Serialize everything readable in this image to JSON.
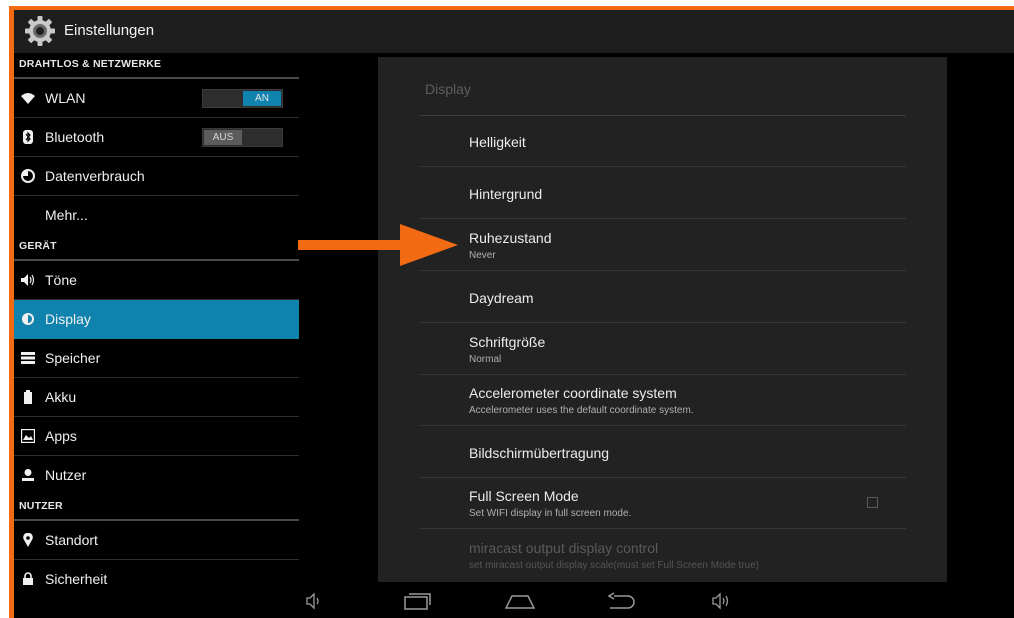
{
  "colors": {
    "accent": "#0f82ad",
    "frame": "#f26b12",
    "arrow": "#f26b12"
  },
  "actionbar": {
    "title": "Einstellungen",
    "icon": "gear-icon"
  },
  "sidebar": {
    "sections": [
      {
        "header": "DRAHTLOS & NETZWERKE",
        "items": [
          {
            "label": "WLAN",
            "icon": "wifi-icon",
            "toggle": "AN"
          },
          {
            "label": "Bluetooth",
            "icon": "bluetooth-icon",
            "toggle": "AUS"
          },
          {
            "label": "Datenverbrauch",
            "icon": "data-usage-icon"
          },
          {
            "label": "Mehr...",
            "icon": ""
          }
        ]
      },
      {
        "header": "GERÄT",
        "items": [
          {
            "label": "Töne",
            "icon": "speaker-icon"
          },
          {
            "label": "Display",
            "icon": "brightness-icon",
            "selected": true
          },
          {
            "label": "Speicher",
            "icon": "storage-icon"
          },
          {
            "label": "Akku",
            "icon": "battery-icon"
          },
          {
            "label": "Apps",
            "icon": "apps-icon"
          },
          {
            "label": "Nutzer",
            "icon": "user-icon"
          }
        ]
      },
      {
        "header": "NUTZER",
        "items": [
          {
            "label": "Standort",
            "icon": "location-icon"
          },
          {
            "label": "Sicherheit",
            "icon": "lock-icon"
          }
        ]
      }
    ]
  },
  "display": {
    "title": "Display",
    "rows": [
      {
        "title": "Helligkeit"
      },
      {
        "title": "Hintergrund"
      },
      {
        "title": "Ruhezustand",
        "summary": "Never"
      },
      {
        "title": "Daydream"
      },
      {
        "title": "Schriftgröße",
        "summary": "Normal"
      },
      {
        "title": "Accelerometer coordinate system",
        "summary": "Accelerometer uses the default coordinate system."
      },
      {
        "title": "Bildschirmübertragung"
      },
      {
        "title": "Full Screen Mode",
        "summary": "Set WIFI display in full screen mode.",
        "checkbox": false
      },
      {
        "title": "miracast output display control",
        "summary": "set miracast output display scale(must set Full Screen Mode true)",
        "disabled": true
      }
    ]
  },
  "navbar": {
    "buttons": [
      "volume-down-icon",
      "recent-apps-icon",
      "home-icon",
      "back-icon",
      "volume-up-icon"
    ]
  }
}
